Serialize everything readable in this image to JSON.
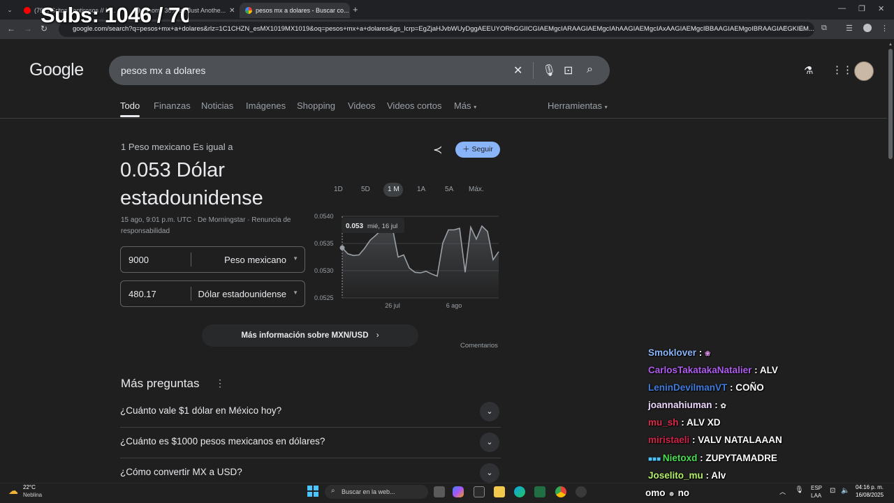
{
  "browser": {
    "tabs": [
      {
        "label": "(795) Gritos Ventirosos // Li...",
        "active": false
      },
      {
        "label": "Ahorro 30% en Just Anothe...",
        "active": false
      },
      {
        "label": "pesos mx a dolares - Buscar co...",
        "active": true
      }
    ],
    "url": "google.com/search?q=pesos+mx+a+dolares&rlz=1C1CHZN_esMX1019MX1019&oq=pesos+mx+a+dolares&gs_lcrp=EgZjaHJvbWUyDggAEEUYORhGGIICGIAEMgcIARAAGIAEMgcIAhAAGIAEMgcIAxAAGIAEMgcIBBAAGIAEMgoIBRAAGIAEGKIEM..."
  },
  "overlay": {
    "subs": "Subs: 1046 / 70"
  },
  "google": {
    "logo": "Google",
    "query": "pesos mx a dolares",
    "nav": [
      "Todo",
      "Finanzas",
      "Noticias",
      "Imágenes",
      "Shopping",
      "Videos",
      "Videos cortos",
      "Más"
    ],
    "tools": "Herramientas"
  },
  "converter": {
    "subtitle": "1 Peso mexicano Es igual a",
    "result": "0.053 Dólar estadounidense",
    "meta": "15 ago, 9:01 p.m. UTC · De Morningstar · Renuncia de responsabilidad",
    "from_amount": "9000",
    "from_currency": "Peso mexicano",
    "to_amount": "480.17",
    "to_currency": "Dólar estadounidense",
    "follow": "Seguir",
    "ranges": [
      "1D",
      "5D",
      "1 M",
      "1A",
      "5A",
      "Máx."
    ],
    "active_range": "1 M",
    "more_info": "Más información sobre MXN/USD",
    "feedback": "Comentarios"
  },
  "chart_data": {
    "type": "line",
    "y_ticks": [
      "0.0540",
      "0.0535",
      "0.0530",
      "0.0525"
    ],
    "ylim": [
      0.0525,
      0.054
    ],
    "x_ticks": [
      "26 jul",
      "6 ago"
    ],
    "tooltip": {
      "value": "0.053",
      "date": "mié, 16 jul"
    },
    "series": [
      {
        "values": [
          0.05342,
          0.05331,
          0.05328,
          0.05329,
          0.05341,
          0.05356,
          0.05365,
          0.05375,
          0.05378,
          0.05378,
          0.05325,
          0.05329,
          0.05305,
          0.05297,
          0.05296,
          0.05299,
          0.05294,
          0.0529,
          0.05351,
          0.05375,
          0.05375,
          0.05378,
          0.05297,
          0.0538,
          0.05358,
          0.05382,
          0.05372,
          0.0532,
          0.05335
        ]
      }
    ],
    "grid": true,
    "color": "#9aa0a6"
  },
  "paa": {
    "title": "Más preguntas",
    "questions": [
      "¿Cuánto vale $1 dólar en México hoy?",
      "¿Cuánto es $1000 pesos mexicanos en dólares?",
      "¿Cómo convertir MX a USD?"
    ]
  },
  "chat": [
    {
      "user": "Smoklover",
      "msg": "",
      "color": "#8ab4f8"
    },
    {
      "user": "CarlosTakatakaNatalier",
      "msg": "ALV",
      "color": "#b05cf0"
    },
    {
      "user": "LeninDevilmanVT",
      "msg": "COÑO",
      "color": "#3f7de0"
    },
    {
      "user": "joannahiuman",
      "msg": "",
      "color": "#f0d9ff"
    },
    {
      "user": "mu_sh",
      "msg": "ALV XD",
      "color": "#e0284a"
    },
    {
      "user": "miristaeli",
      "msg": "VALV NATALAAAN",
      "color": "#d2224a"
    },
    {
      "user": "Nietoxd",
      "msg": "ZUPYTAMADRE",
      "color": "#48e04e"
    },
    {
      "user": "Joselito_mu",
      "msg": "Alv",
      "color": "#b4f06a"
    },
    {
      "user": "omo",
      "msg": "no",
      "color": "#ffffff"
    }
  ],
  "taskbar": {
    "temp": "22°C",
    "weather": "Neblina",
    "search": "Buscar en la web...",
    "lang1": "ESP",
    "lang2": "LAA",
    "time": "04:16 p. m.",
    "date": "16/08/2025"
  }
}
